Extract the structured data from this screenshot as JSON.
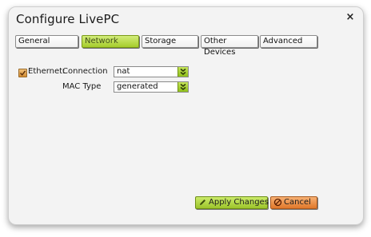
{
  "dialog": {
    "title": "Configure LivePC",
    "close_symbol": "×"
  },
  "tabs": [
    {
      "label": "General"
    },
    {
      "label": "Network",
      "active": true
    },
    {
      "label": "Storage"
    },
    {
      "label": "Other Devices"
    },
    {
      "label": "Advanced"
    }
  ],
  "ethernet": {
    "label": "Ethernet:",
    "checked": true,
    "connection_label": "Connection",
    "connection_value": "nat",
    "mac_type_label": "MAC Type",
    "mac_type_value": "generated"
  },
  "buttons": {
    "apply_label": "Apply Changes",
    "cancel_label": "Cancel"
  },
  "colors": {
    "accent_green": "#a6cd2c",
    "cancel_orange": "#e1782a",
    "checkbox_orange": "#d28c33"
  },
  "icons": {
    "close": "close-icon",
    "checkbox": "checkmark-icon",
    "dropdown": "double-chevron-down-icon",
    "apply": "pencil-icon",
    "cancel": "cancel-circle-icon"
  }
}
